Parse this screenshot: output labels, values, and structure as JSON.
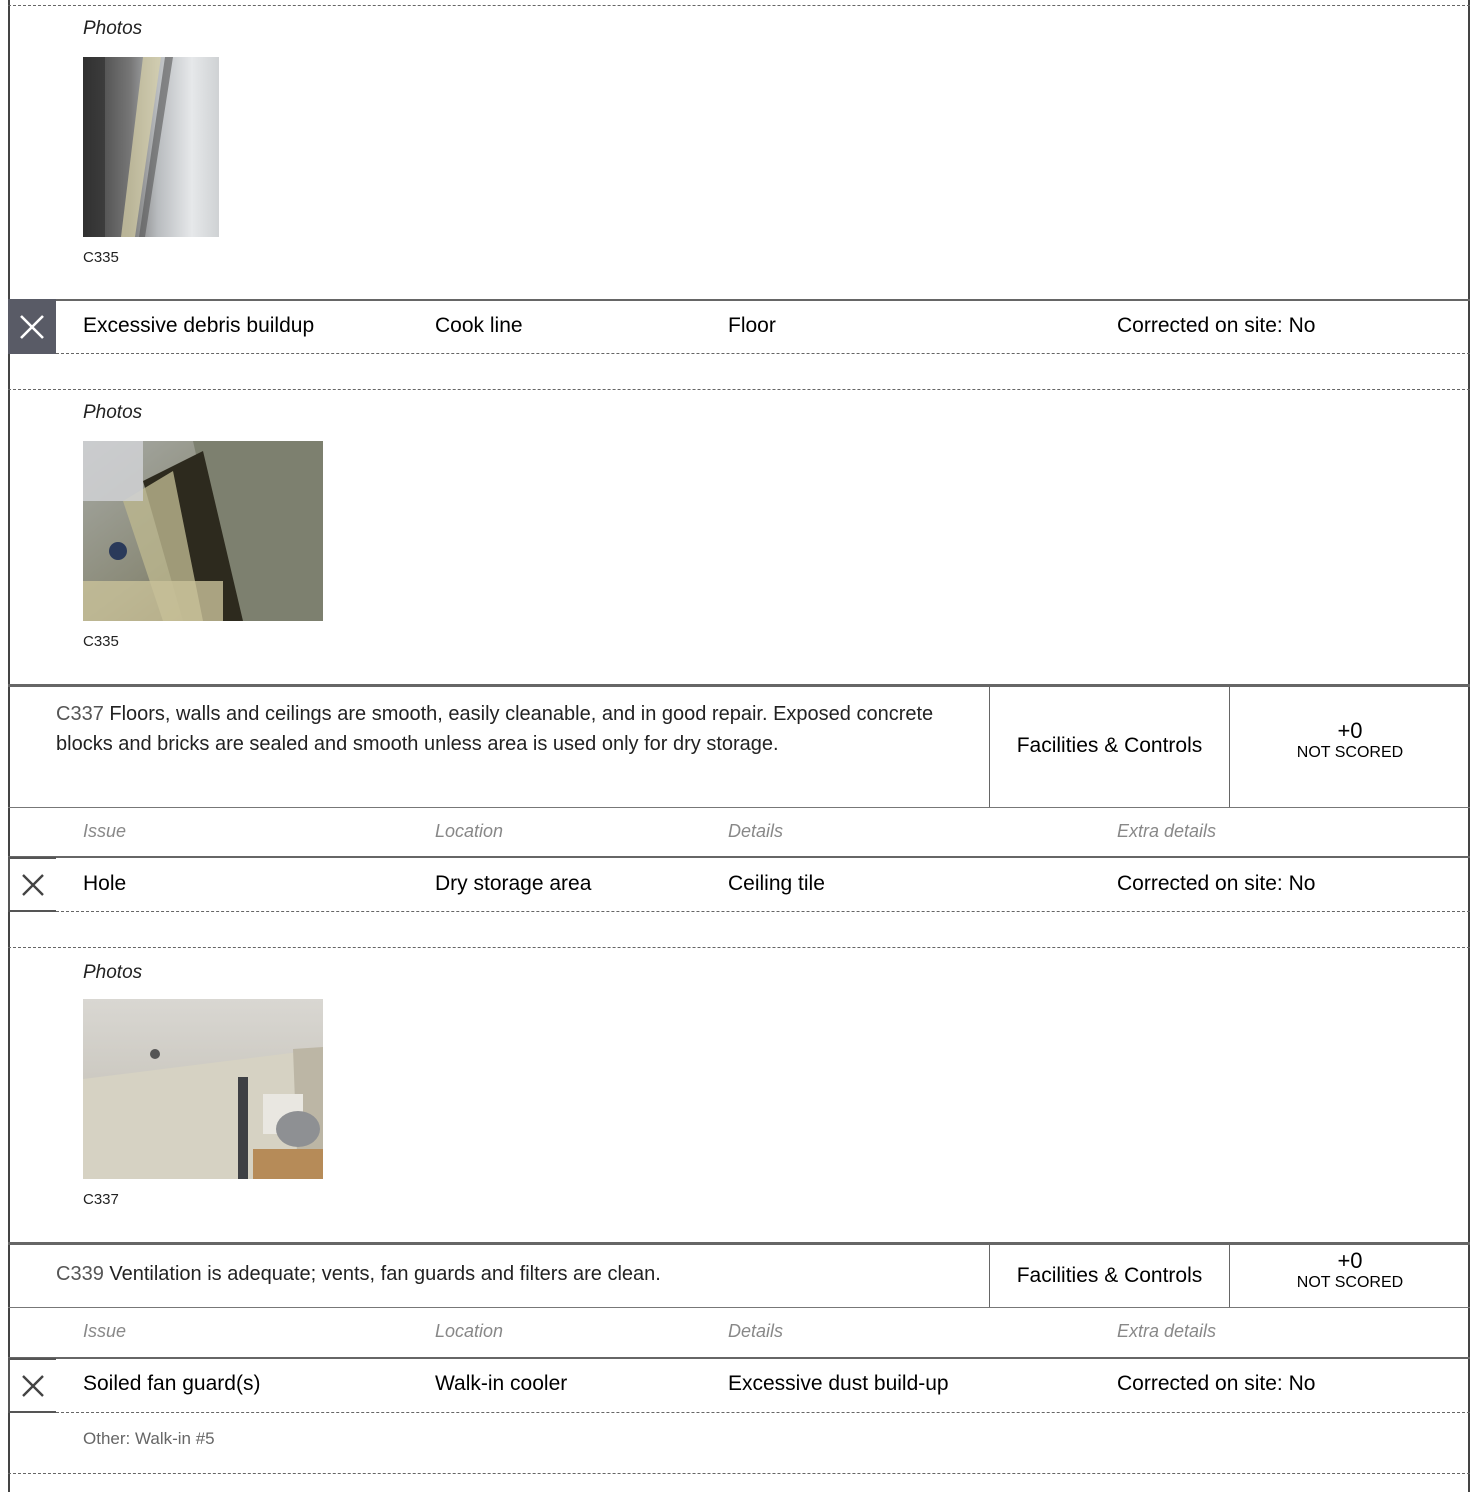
{
  "top_section": {
    "photos_label": "Photos",
    "photo_caption": "C335"
  },
  "issue_debris": {
    "issue": "Excessive debris buildup",
    "location": "Cook line",
    "details": "Floor",
    "extra": "Corrected on site: No",
    "photos_label": "Photos",
    "photo_caption": "C335"
  },
  "c337": {
    "code": "C337",
    "description": " Floors, walls and ceilings are smooth, easily cleanable, and in good repair. Exposed concrete blocks and bricks are sealed and smooth unless area is used only for dry storage.",
    "category": "Facilities & Controls",
    "points": "+0",
    "status": "NOT SCORED",
    "headers": {
      "issue": "Issue",
      "location": "Location",
      "details": "Details",
      "extra": "Extra details"
    },
    "issue": "Hole",
    "location": "Dry storage area",
    "details": "Ceiling tile",
    "extra": "Corrected on site: No",
    "photos_label": "Photos",
    "photo_caption": "C337"
  },
  "c339": {
    "code": "C339",
    "description": " Ventilation is adequate; vents, fan guards and filters are clean.",
    "category": "Facilities & Controls",
    "points": "+0",
    "status": "NOT SCORED",
    "headers": {
      "issue": "Issue",
      "location": "Location",
      "details": "Details",
      "extra": "Extra details"
    },
    "issue": "Soiled fan guard(s)",
    "location": "Walk-in cooler",
    "details": "Excessive dust build-up",
    "extra": "Corrected on site: No",
    "other_note": "Other: Walk-in #5"
  },
  "colors": {
    "x_box_filled": "#595b66",
    "border": "#666666",
    "header_text": "#888888"
  }
}
